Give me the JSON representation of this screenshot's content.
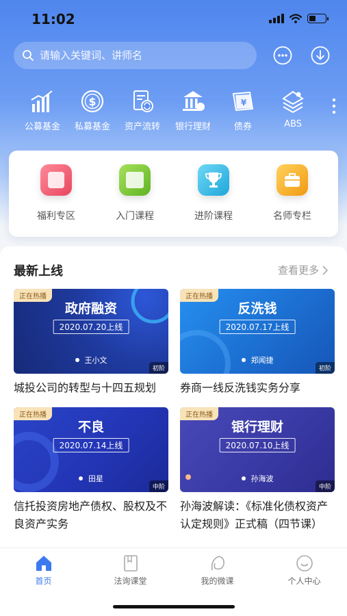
{
  "status": {
    "time": "11:02"
  },
  "search": {
    "placeholder": "请输入关键词、讲师名"
  },
  "header_icons": [
    "message-icon",
    "download-icon"
  ],
  "categories": [
    {
      "label": "公募基金",
      "icon": "bar-chart-icon"
    },
    {
      "label": "私募基金",
      "icon": "dollar-coin-icon"
    },
    {
      "label": "资产流转",
      "icon": "document-refresh-icon"
    },
    {
      "label": "银行理财",
      "icon": "bank-icon"
    },
    {
      "label": "债券",
      "icon": "yen-bond-icon"
    },
    {
      "label": "ABS",
      "icon": "layers-icon"
    }
  ],
  "quick_links": [
    {
      "label": "福利专区",
      "color": "#f0576f"
    },
    {
      "label": "入门课程",
      "color": "#7bc936"
    },
    {
      "label": "进阶课程",
      "color": "#36bde6"
    },
    {
      "label": "名师专栏",
      "color": "#f7b21e"
    }
  ],
  "section": {
    "title": "最新上线",
    "more": "查看更多"
  },
  "courses": [
    {
      "badge": "正在热播",
      "title": "政府融资",
      "date": "2020.07.20上线",
      "lecturer": "王小文",
      "level": "初阶",
      "name": "城投公司的转型与十四五规划",
      "bg": "#1f3a9e"
    },
    {
      "badge": "正在热播",
      "title": "反洗钱",
      "date": "2020.07.17上线",
      "lecturer": "郑闻捷",
      "level": "初阶",
      "name": "券商一线反洗钱实务分享",
      "bg": "#1c78d6"
    },
    {
      "badge": "正在热播",
      "title": "不良",
      "date": "2020.07.14上线",
      "lecturer": "田星",
      "level": "中阶",
      "name": "信托投资房地产债权、股权及不良资产实务",
      "bg": "#2335b6"
    },
    {
      "badge": "正在热播",
      "title": "银行理财",
      "date": "2020.07.10上线",
      "lecturer": "孙海波",
      "level": "中阶",
      "name": "孙海波解读：《标准化债权资产认定规则》正式稿（四节课）",
      "bg": "#3a3aa6"
    }
  ],
  "tabs": [
    {
      "label": "首页",
      "icon": "home-icon",
      "active": true
    },
    {
      "label": "法询课堂",
      "icon": "book-icon",
      "active": false
    },
    {
      "label": "我的微课",
      "icon": "leaf-icon",
      "active": false
    },
    {
      "label": "个人中心",
      "icon": "smile-icon",
      "active": false
    }
  ]
}
